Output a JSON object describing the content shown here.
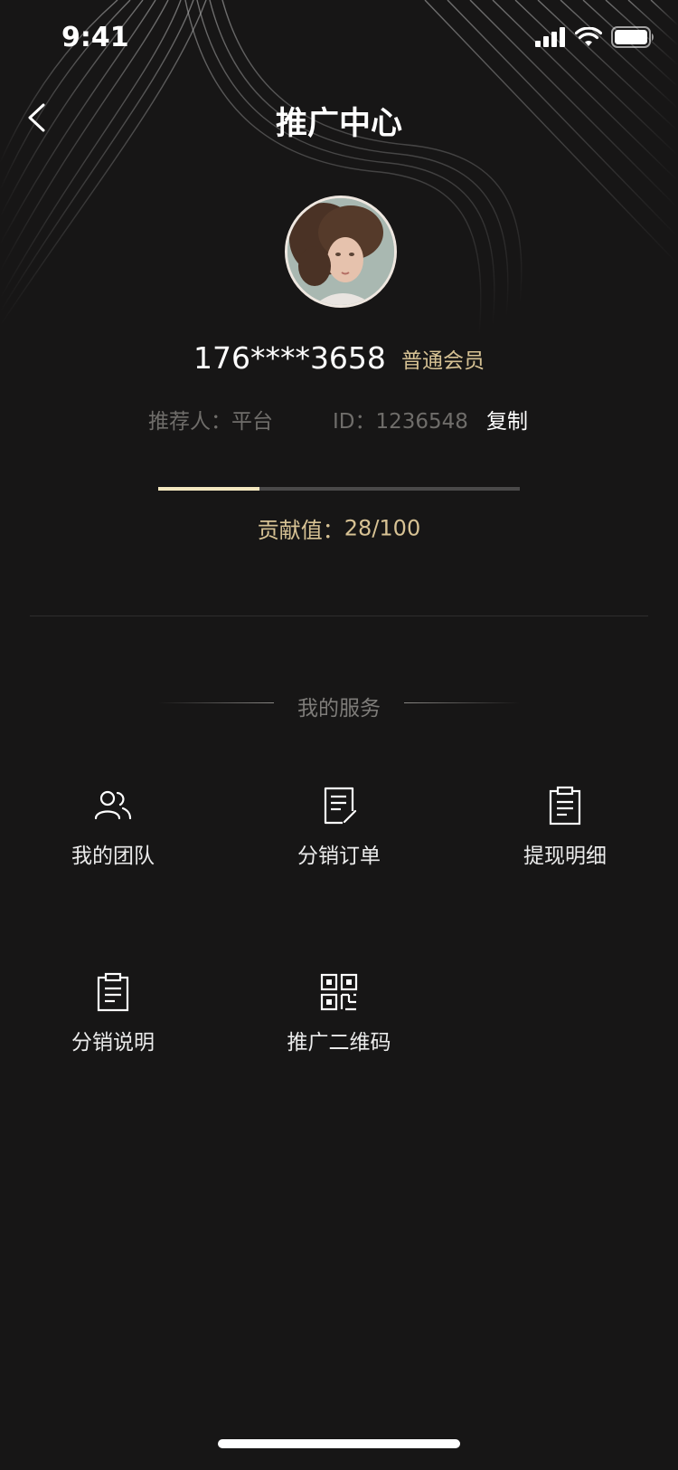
{
  "status_bar": {
    "time": "9:41",
    "icons": [
      "signal-icon",
      "wifi-icon",
      "battery-icon"
    ]
  },
  "nav": {
    "title": "推广中心",
    "back_icon": "chevron-left-icon"
  },
  "profile": {
    "avatar": "avatar",
    "phone": "176****3658",
    "level": "普通会员",
    "referrer_label": "推荐人：",
    "referrer_value": "平台",
    "id_label": "ID：",
    "id_value": "1236548",
    "copy_label": "复制"
  },
  "contribution": {
    "label": "贡献值：",
    "current": 28,
    "max": 100,
    "display": "28/100"
  },
  "services": {
    "title": "我的服务",
    "items": [
      {
        "label": "我的团队",
        "icon": "team-icon"
      },
      {
        "label": "分销订单",
        "icon": "order-icon"
      },
      {
        "label": "提现明细",
        "icon": "clipboard-icon"
      },
      {
        "label": "分销说明",
        "icon": "clipboard-icon"
      },
      {
        "label": "推广二维码",
        "icon": "qrcode-icon"
      }
    ]
  },
  "colors": {
    "background": "#171616",
    "accent_gold": "#d7c294",
    "progress_fill": "#f3e7bf",
    "progress_track": "#4a4949",
    "muted_text": "#6f6d6a"
  }
}
